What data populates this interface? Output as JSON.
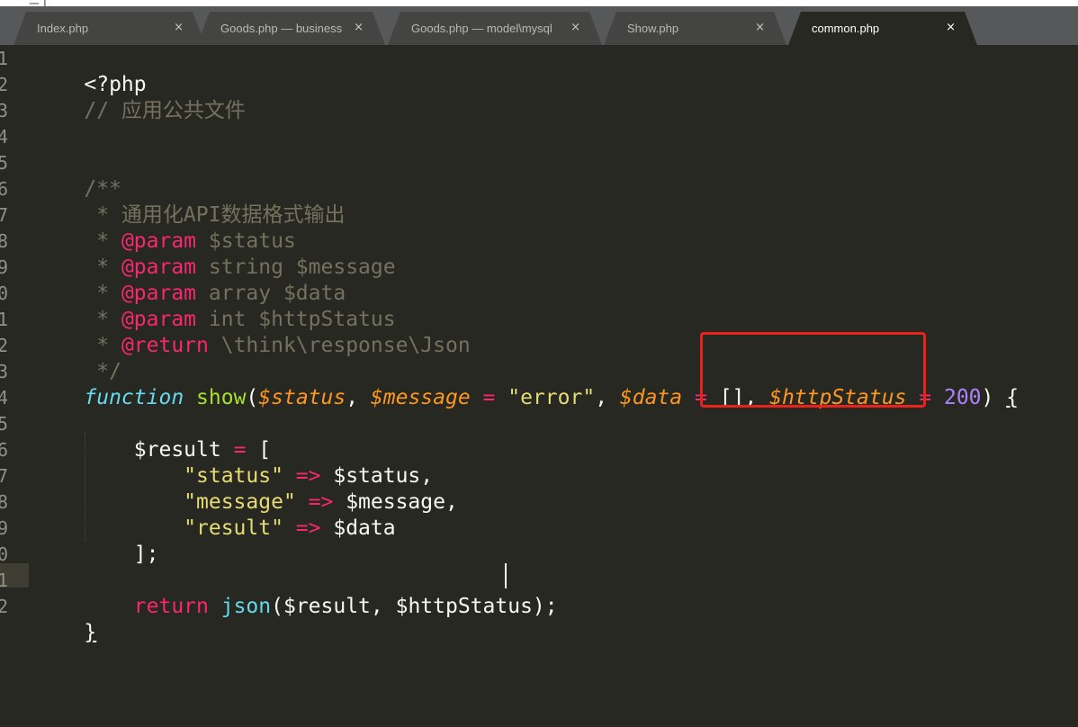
{
  "window": {
    "title_glyph": "三 |"
  },
  "tabs": [
    {
      "label": "Index.php",
      "close": "×",
      "active": false
    },
    {
      "label": "Goods.php — business",
      "close": "×",
      "active": false
    },
    {
      "label": "Goods.php — model\\mysql",
      "close": "×",
      "active": false
    },
    {
      "label": "Show.php",
      "close": "×",
      "active": false
    },
    {
      "label": "common.php",
      "close": "×",
      "active": true
    }
  ],
  "editor": {
    "current_line": 21,
    "line_numbers": [
      "1",
      "2",
      "3",
      "4",
      "5",
      "6",
      "7",
      "8",
      "9",
      "0",
      "1",
      "2",
      "3",
      "4",
      "5",
      "6",
      "7",
      "8",
      "9",
      "0",
      "1",
      "2"
    ],
    "code": {
      "l1": "<?php",
      "l2": "// 应用公共文件",
      "l5": "/**",
      "l6": " * 通用化API数据格式输出",
      "l7_star": " * ",
      "l7_tag": "@param",
      "l7_rest": " $status",
      "l8_star": " * ",
      "l8_tag": "@param",
      "l8_rest": " string $message",
      "l9_star": " * ",
      "l9_tag": "@param",
      "l9_rest": " array $data",
      "l10_star": " * ",
      "l10_tag": "@param",
      "l10_rest": " int $httpStatus",
      "l11_star": " * ",
      "l11_tag": "@return",
      "l11_rest": " \\think\\response\\Json",
      "l12": " */",
      "l13_kw": "function",
      "l13_sp": " ",
      "l13_fn": "show",
      "l13_p1": "(",
      "l13_a1": "$status",
      "l13_c1": ", ",
      "l13_a2": "$message",
      "l13_eq1": " = ",
      "l13_s1": "\"error\"",
      "l13_c2": ", ",
      "l13_a3": "$data",
      "l13_eq2": " = ",
      "l13_arr": "[]",
      "l13_c3": ", ",
      "l13_a4": "$httpStatus",
      "l13_eq3": " = ",
      "l13_n1": "200",
      "l13_p2": ") ",
      "l13_br": "{",
      "l15_var": "    $result",
      "l15_eq": " = ",
      "l15_br": "[",
      "l16_key": "        \"status\"",
      "l16_arrow": " => ",
      "l16_val": "$status,",
      "l17_key": "        \"message\"",
      "l17_arrow": " => ",
      "l17_val": "$message,",
      "l18_key": "        \"result\"",
      "l18_arrow": " => ",
      "l18_val": "$data",
      "l19": "    ];",
      "l21_kw": "    return",
      "l21_sp": " ",
      "l21_fn": "json",
      "l21_rest": "($result, $httpStatus);",
      "l22": "}"
    }
  },
  "colors": {
    "background": "#272822",
    "highlight_box": "#e8231c",
    "keyword": "#f92672",
    "function": "#a6e22e",
    "parameter": "#fd971f",
    "string": "#e6db74",
    "number": "#ae81ff",
    "comment": "#75715e"
  }
}
